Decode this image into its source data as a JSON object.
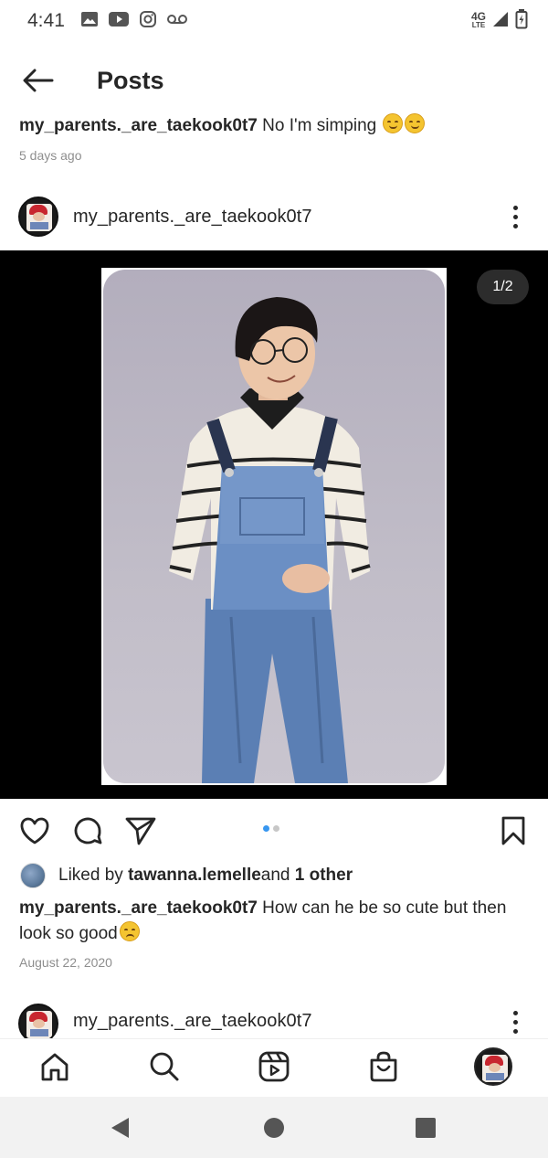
{
  "status_bar": {
    "time": "4:41",
    "network": "4G",
    "network_sub": "LTE"
  },
  "header": {
    "title": "Posts"
  },
  "previous_post": {
    "username": "my_parents._are_taekook0t7",
    "caption": " No I'm simping ",
    "time_ago": "5 days ago"
  },
  "post": {
    "username": "my_parents._are_taekook0t7",
    "page_counter": "1/2",
    "carousel_total": 2,
    "carousel_index": 1,
    "likes": {
      "prefix": "Liked by ",
      "user": "tawanna.lemelle",
      "middle": " and ",
      "others": "1 other"
    },
    "caption": " How can he be so cute but then look so good",
    "date": "August 22, 2020"
  },
  "next_post": {
    "username": "my_parents._are_taekook0t7"
  },
  "colors": {
    "accent": "#3897f0",
    "text": "#262626",
    "muted": "#8e8e8e",
    "media_bg": "#000000"
  },
  "icons": {
    "status_left": [
      "gallery-icon",
      "youtube-icon",
      "instagram-icon",
      "voicemail-icon"
    ],
    "status_right": [
      "signal-icon",
      "battery-icon"
    ],
    "actions": [
      "heart-icon",
      "comment-icon",
      "share-icon",
      "bookmark-icon"
    ],
    "bottom_nav": [
      "home-icon",
      "search-icon",
      "reels-icon",
      "shop-icon",
      "profile-avatar"
    ],
    "system_nav": [
      "back-triangle-icon",
      "home-circle-icon",
      "recents-square-icon"
    ]
  }
}
